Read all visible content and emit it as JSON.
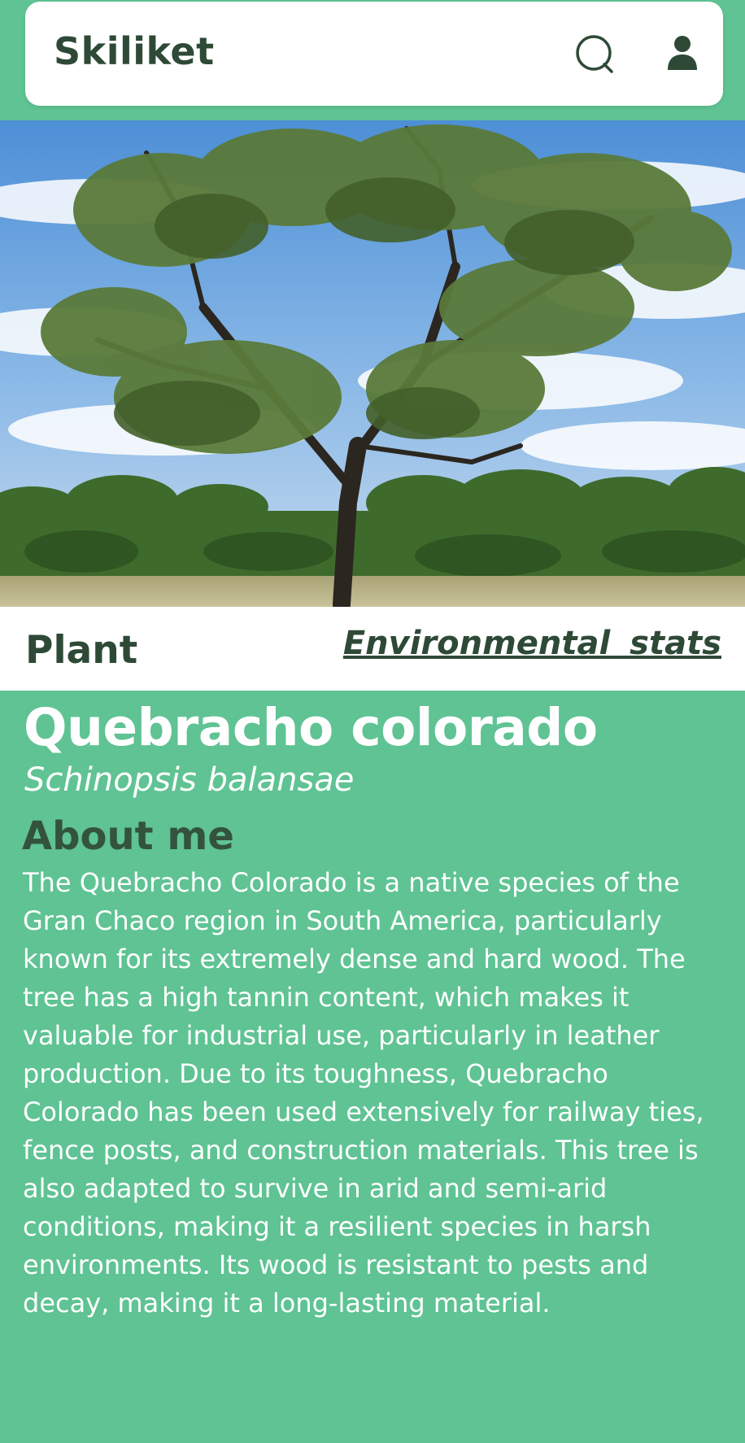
{
  "header": {
    "title": "Skiliket",
    "icons": [
      "search-icon",
      "user-icon"
    ]
  },
  "hero": {
    "icon": "tree-photo"
  },
  "infobar": {
    "category": "Plant",
    "stats_link": "Environmental  stats"
  },
  "species": {
    "common_name": "Quebracho colorado",
    "scientific_name": "Schinopsis balansae"
  },
  "about": {
    "title": "About me",
    "body": "The Quebracho Colorado is a native species of the Gran Chaco region in South America, particularly known for its extremely dense and hard wood. The tree has a high tannin content, which makes it valuable for industrial use, particularly in leather production. Due to its toughness, Quebracho Colorado has been used extensively for railway ties, fence posts, and construction materials. This tree is also adapted to survive in arid and semi-arid conditions, making it a resilient species in harsh environments. Its wood is resistant to pests and decay, making it a long-lasting material."
  },
  "colors": {
    "background": "#5fc393",
    "header_bg": "#ffffff",
    "dark_text": "#2e4a37",
    "light_text": "#ffffff"
  }
}
